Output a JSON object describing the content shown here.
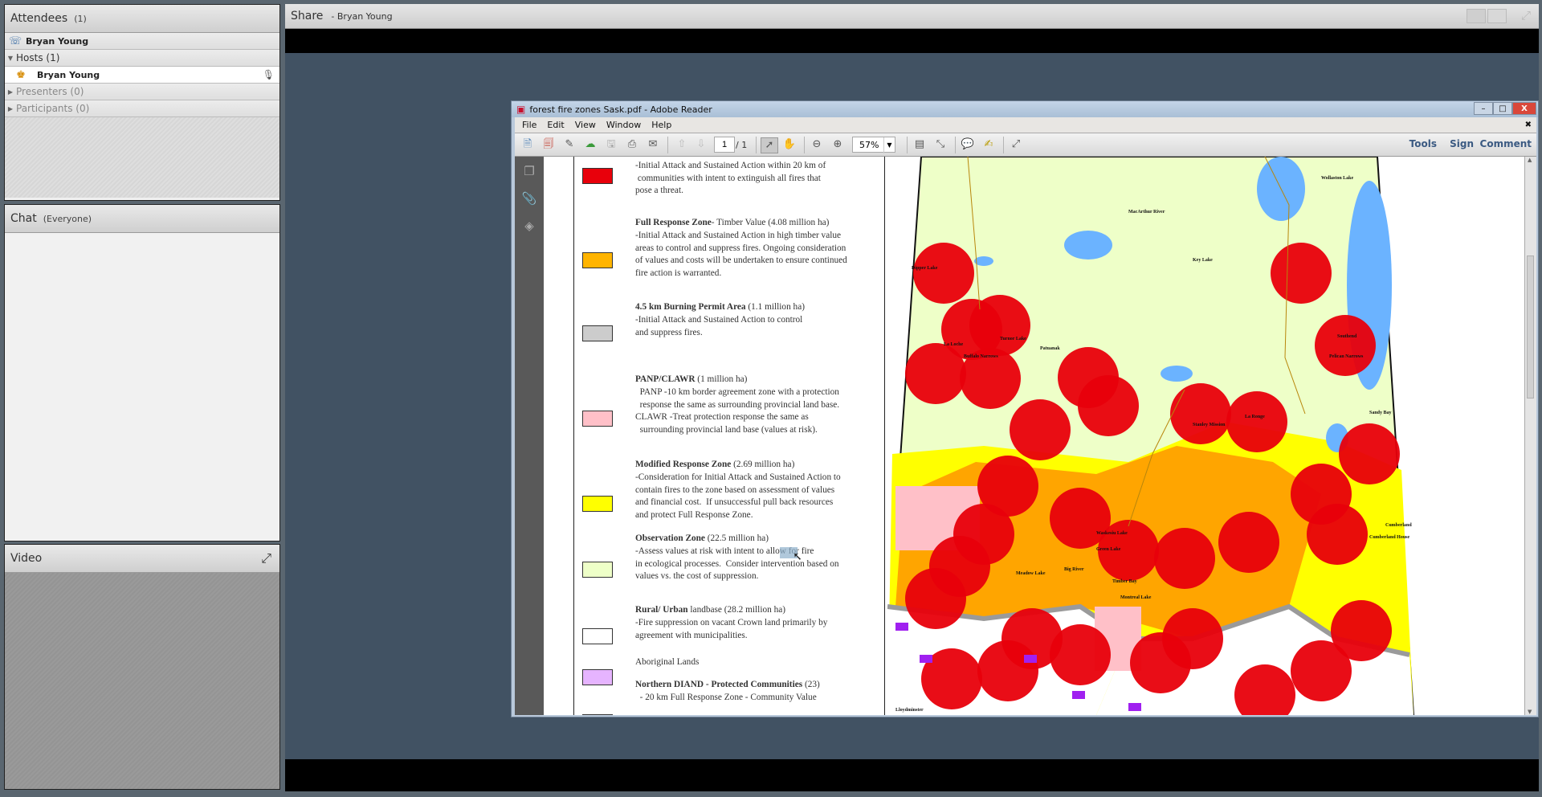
{
  "attendees": {
    "title": "Attendees",
    "count": "(1)",
    "me": "Bryan Young",
    "groups": [
      {
        "label": "Hosts (1)",
        "expanded": true,
        "members": [
          "Bryan Young"
        ]
      },
      {
        "label": "Presenters (0)",
        "expanded": false,
        "members": []
      },
      {
        "label": "Participants (0)",
        "expanded": false,
        "members": []
      }
    ]
  },
  "chat": {
    "title": "Chat",
    "scope": "(Everyone)"
  },
  "video": {
    "title": "Video"
  },
  "share": {
    "title": "Share",
    "presenter": "- Bryan Young"
  },
  "reader": {
    "title": "forest fire zones Sask.pdf - Adobe Reader",
    "menu": [
      "File",
      "Edit",
      "View",
      "Window",
      "Help"
    ],
    "page_current": "1",
    "page_total": "/ 1",
    "zoom": "57%",
    "panes": [
      "Tools",
      "Sign",
      "Comment"
    ],
    "window_buttons": {
      "minimize": "–",
      "maximize": "□",
      "close": "X"
    },
    "close_doc": "✖"
  },
  "legend": [
    {
      "color": "#e8000b",
      "title": "",
      "title_rest": "",
      "lines": [
        "-Initial Attack and Sustained Action within 20 km of",
        " communities with intent to extinguish all fires that",
        "pose a threat."
      ]
    },
    {
      "color": "#ffb400",
      "title": "Full Response Zone",
      "title_rest": "- Timber Value (4.08 million ha)",
      "lines": [
        "-Initial Attack and Sustained Action in high timber value",
        "areas to control and suppress fires. Ongoing consideration",
        "of values and costs will be undertaken to ensure continued",
        "fire action is warranted."
      ]
    },
    {
      "color": "#cccccc",
      "title": "4.5 km Burning Permit Area",
      "title_rest": " (1.1 million ha)",
      "lines": [
        "-Initial Attack and Sustained Action to control",
        "and suppress fires."
      ]
    },
    {
      "color": "#ffc0c8",
      "title": "PANP/CLAWR",
      "title_rest": " (1 million ha)",
      "lines": [
        "  PANP -10 km border agreement zone with a protection",
        "  response the same as surrounding provincial land base.",
        "CLAWR -Treat protection response the same as",
        "  surrounding provincial land base (values at risk)."
      ]
    },
    {
      "color": "#ffff00",
      "title": "Modified Response Zone",
      "title_rest": " (2.69 million ha)",
      "lines": [
        "-Consideration for Initial Attack and Sustained Action to",
        "contain fires to the zone based on assessment of values",
        "and financial cost.  If unsuccessful pull back resources",
        "and protect Full Response Zone."
      ]
    },
    {
      "color": "#eeffc8",
      "title": "Observation Zone",
      "title_rest": " (22.5 million ha)",
      "lines": [
        "-Assess values at risk with intent to allow for fire",
        "in ecological processes.  Consider intervention based on",
        "values vs. the cost of suppression."
      ]
    },
    {
      "color": "#ffffff",
      "title": "Rural/ Urban",
      "title_rest": " landbase (28.2 million ha)",
      "lines": [
        "-Fire suppression on vacant Crown land primarily by",
        "agreement with municipalities."
      ]
    },
    {
      "color": "#e6b4ff",
      "title": "",
      "title_rest": "Aboriginal Lands",
      "lines": []
    },
    {
      "color": "#8a2be2",
      "title": "Northern DIAND - Protected Communities",
      "title_rest": " (23)",
      "lines": [
        "  - 20 km Full Response Zone - Community Value"
      ]
    }
  ],
  "map": {
    "labels": [
      "MacArthur River",
      "Key Lake",
      "Wollaston Lake",
      "Dipper Lake",
      "La Loche",
      "Buffalo Narrows",
      "Turnor Lake",
      "Patuanak",
      "Stanley Mission",
      "La Ronge",
      "Pelican Narrows",
      "Sandy Bay",
      "Cumberland House",
      "Big River",
      "Montreal Lake",
      "Timber Bay",
      "Lloydminster",
      "Meadow Lake",
      "Waskesiu Lake",
      "Green Lake",
      "Cumberland",
      "Southend"
    ]
  }
}
